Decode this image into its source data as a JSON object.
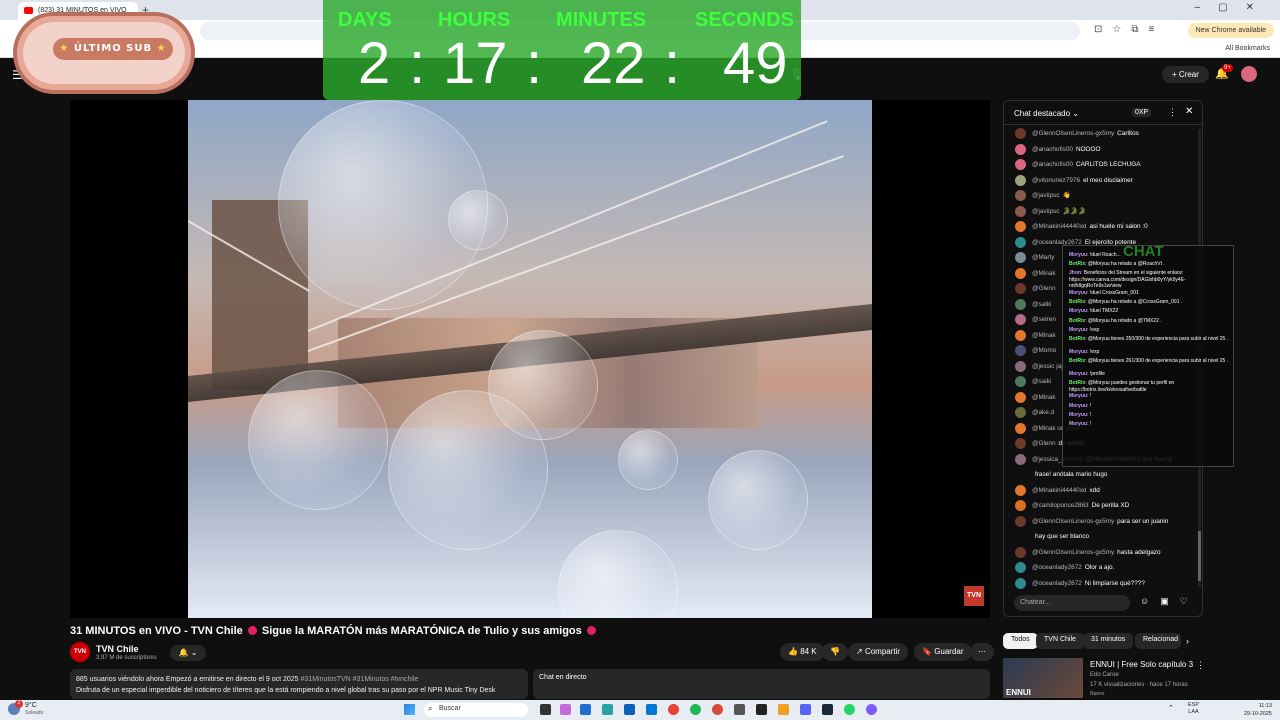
{
  "browser": {
    "tab_title": "(823) 31 MINUTOS en VIVO",
    "new_chrome_label": "New Chrome available",
    "all_bookmarks": "All Bookmarks"
  },
  "overlay": {
    "hotdog_label": "ÚLTIMO SUB",
    "countdown": {
      "days_label": "DAYS",
      "hours_label": "HOURS",
      "minutes_label": "MINUTES",
      "seconds_label": "SECONDS",
      "days": "2",
      "hours": "17",
      "minutes": "22",
      "seconds": "49",
      "sep": ":"
    },
    "bot_chat_title": "CHAT"
  },
  "header": {
    "create_label": "Crear",
    "notification_count": "9+"
  },
  "player": {
    "channel_bug": "TVN"
  },
  "video": {
    "title_part1": "31 MINUTOS en VIVO - TVN Chile",
    "title_part2": "Sigue la MARATÓN más MARATÓNICA de Tulio y sus amigos",
    "channel_name": "TVN Chile",
    "channel_avatar_text": "TVN",
    "subscribers": "3,97 M de suscriptores",
    "likes": "84 K",
    "share_label": "Compartir",
    "save_label": "Guardar",
    "desc_line1": "885 usuarios viéndolo ahora  Empezó a emitirse en directo el 9 oct 2025",
    "desc_tags": "#31MinutosTVN #31Minutos #tvnchile",
    "desc_line2": "Disfruta de un especial imperdible del noticiero de títeres que la está rompiendo a nivel global tras su paso por el NPR Music Tiny Desk",
    "live_chat_label": "Chat en directo"
  },
  "chat": {
    "title": "Chat destacado",
    "xp": "0XP",
    "input_placeholder": "Chatear...",
    "messages": [
      {
        "author": "@GlennOlsenLineros-gx5my",
        "text": "Carlitos",
        "color": "#6b3a2a"
      },
      {
        "author": "@anachofis00",
        "text": "NOOOO",
        "color": "#d9687e"
      },
      {
        "author": "@anachofis00",
        "text": "CARLITOS LECHUGA",
        "color": "#d9687e"
      },
      {
        "author": "@vitonunez7976",
        "text": "el meo disclaimer",
        "color": "#9aa47c"
      },
      {
        "author": "@javiipsc",
        "text": "👋",
        "color": "#8a5a4a"
      },
      {
        "author": "@javiipsc",
        "text": "🐊🐊🐊",
        "color": "#8a5a4a"
      },
      {
        "author": "@Minakini44440xd",
        "text": "asi huele mi salon :0",
        "color": "#e2762b"
      },
      {
        "author": "@oceanlady2672",
        "text": "El ejercito potente",
        "color": "#2e8b8b"
      },
      {
        "author": "@Marty",
        "text": "",
        "color": "#7a8c9a"
      },
      {
        "author": "@Minak",
        "text": "",
        "color": "#e2762b"
      },
      {
        "author": "@Glenn",
        "text": "",
        "color": "#6b3a2a"
      },
      {
        "author": "@salki",
        "text": "",
        "color": "#4f7a5a"
      },
      {
        "author": "@selren",
        "text": "",
        "color": "#b56a8a"
      },
      {
        "author": "@Minak",
        "text": "",
        "color": "#e2762b"
      },
      {
        "author": "@Momo",
        "text": "",
        "color": "#4a4f7a"
      },
      {
        "author": "@jessic jaja",
        "text": "",
        "color": "#8a6a7a"
      },
      {
        "author": "@saiki",
        "text": "",
        "color": "#4f7a5a"
      },
      {
        "author": "@Minak",
        "text": "",
        "color": "#e2762b"
      },
      {
        "author": "@ake.d",
        "text": "",
        "color": "#6a6a3a"
      },
      {
        "author": "@Minak un juani",
        "text": "",
        "color": "#e2762b"
      },
      {
        "author": "@Glenn",
        "text": "de perilla",
        "color": "#6b3a2a"
      },
      {
        "author": "@jessica_amomo",
        "text": "@Minakini44440xd que buena",
        "color": "#8a6a7a"
      },
      {
        "author": "",
        "text": "frase! anótala mario hugo",
        "color": ""
      },
      {
        "author": "@Minakini44440xd",
        "text": "xdd",
        "color": "#e2762b"
      },
      {
        "author": "@camiloponce2863",
        "text": "De perilla XD",
        "color": "#d9701f"
      },
      {
        "author": "@GlennOlsenLineros-gx5my",
        "text": "para ser un juanin",
        "color": "#6b3a2a"
      },
      {
        "author": "",
        "text": "hay que ser blanco",
        "color": ""
      },
      {
        "author": "@GlennOlsenLineros-gx5my",
        "text": "hasta adelgazo",
        "color": "#6b3a2a"
      },
      {
        "author": "@oceanlady2672",
        "text": "Olor a ajo.",
        "color": "#2e8b8b"
      },
      {
        "author": "@oceanlady2672",
        "text": "Ni limpiarse qué????",
        "color": "#2e8b8b"
      }
    ],
    "bot_lines": [
      {
        "name": "Moryuu",
        "text": ": !duel Roach..."
      },
      {
        "name": "BotRix",
        "text": ": @Moryuu ha retado a @RoachVt ."
      },
      {
        "name": "Jhon",
        "text": ": Beneficios del Stream en el siguiente enlace: https://www.canva.com/design/DAGlshb0yY/yk9y4E-nnlh8gqRoTe9s1w/view"
      },
      {
        "name": "Moryuu",
        "text": ": !duel CrossGram_001"
      },
      {
        "name": "BotRix",
        "text": ": @Moryuu ha retado a @CrossGram_001 ."
      },
      {
        "name": "Moryuu",
        "text": ": !duel TMX22"
      },
      {
        "name": "BotRix",
        "text": ": @Moryuu ha retado a @TMX22 ."
      },
      {
        "name": "Moryuu",
        "text": ": !exp"
      },
      {
        "name": "BotRix",
        "text": ": @Moryuu tienes 250/300 de experiencia para subir al nivel 25 ."
      },
      {
        "name": "Moryuu",
        "text": ": !exp"
      },
      {
        "name": "BotRix",
        "text": ": @Moryuu tienes 261/300 de experiencia para subir al nivel 25 ."
      },
      {
        "name": "Moryuu",
        "text": ": !profile"
      },
      {
        "name": "BotRix",
        "text": ": @Moryuu puedes gestionar tu perfil en https://botrix.live/k/eleosafive/battle"
      },
      {
        "name": "Moryuu",
        "text": ": !"
      },
      {
        "name": "Moryuu",
        "text": ": !"
      },
      {
        "name": "Moryuu",
        "text": ": !"
      },
      {
        "name": "Moryuu",
        "text": ": !"
      }
    ]
  },
  "recommendations": {
    "chips": [
      "Todos",
      "TVN Chile",
      "31 minutos",
      "Relacionad"
    ],
    "item": {
      "title": "ENNUI | Free Solo capítulo 3",
      "channel": "Edo Caroe",
      "meta": "17 K visualizaciones · hace 17 horas",
      "badge": "Nuevo",
      "thumb_text": "ENNUI"
    }
  },
  "taskbar": {
    "temp": "9°C",
    "condition": "Soleado",
    "weather_badge": "2",
    "search_label": "Buscar",
    "lang": "ESP",
    "lang2": "LAA",
    "time": "11:13",
    "date": "29-10-2025"
  }
}
